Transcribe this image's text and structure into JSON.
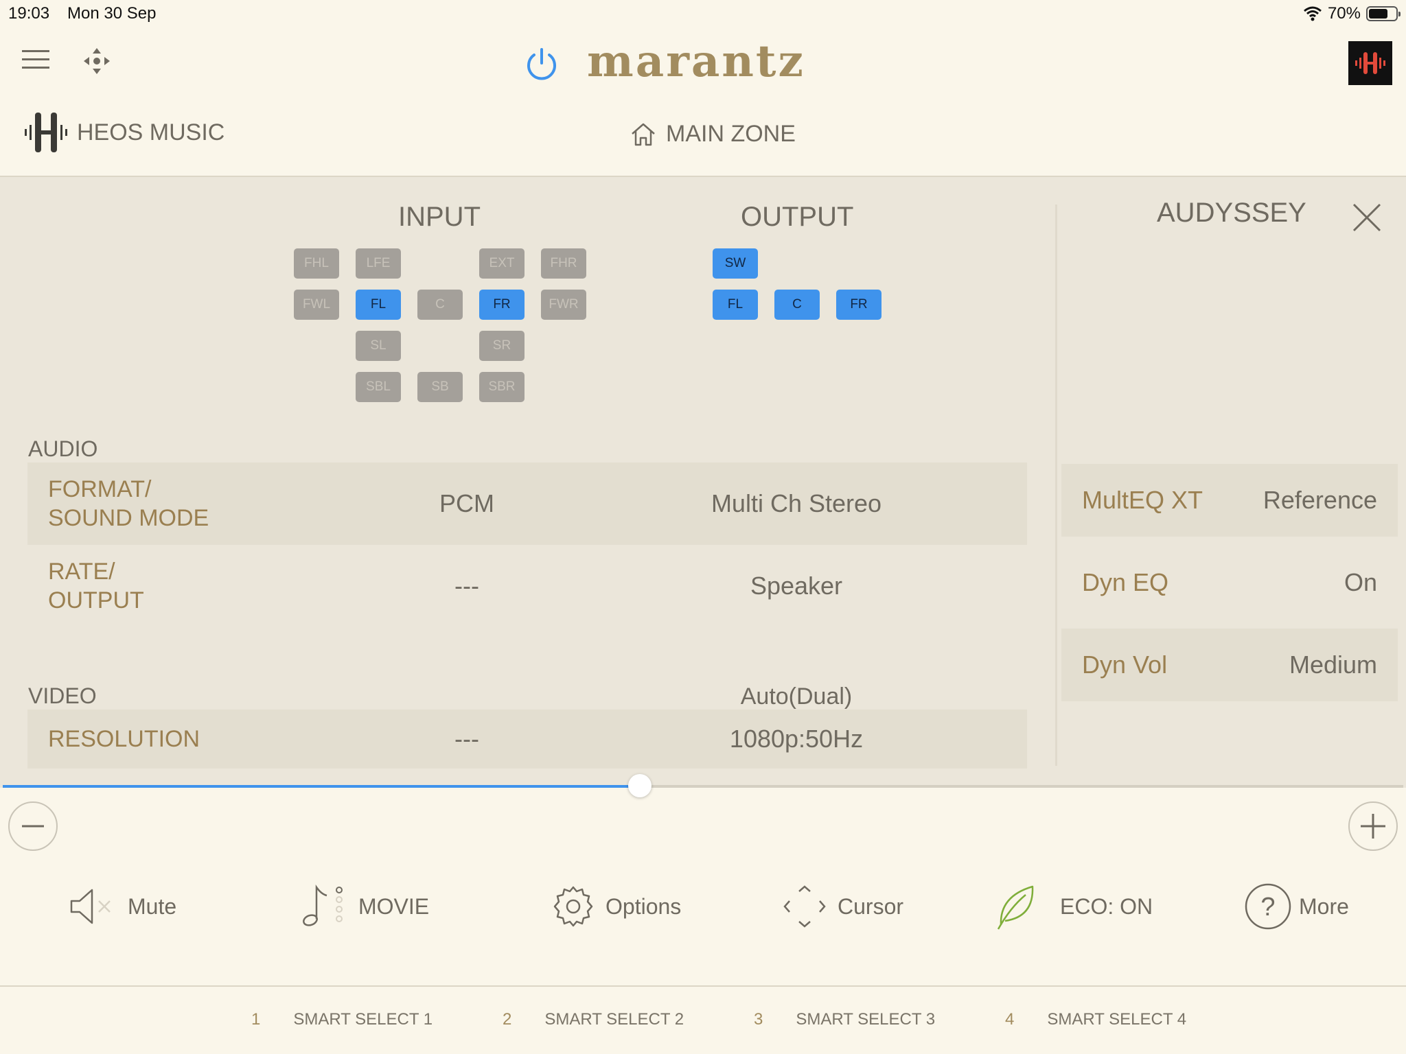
{
  "status": {
    "time": "19:03",
    "date": "Mon 30 Sep",
    "battery": "70%",
    "battery_level": 0.7
  },
  "header": {
    "brand": "marantz",
    "source_tab": "HEOS MUSIC",
    "zone": "MAIN ZONE"
  },
  "panel": {
    "input_title": "INPUT",
    "output_title": "OUTPUT",
    "audyssey_title": "AUDYSSEY",
    "input_channels": [
      {
        "label": "FHL",
        "active": false
      },
      {
        "label": "LFE",
        "active": false
      },
      {
        "label": "EXT",
        "active": false
      },
      {
        "label": "FHR",
        "active": false
      },
      {
        "label": "FWL",
        "active": false
      },
      {
        "label": "FL",
        "active": true
      },
      {
        "label": "C",
        "active": false
      },
      {
        "label": "FR",
        "active": true
      },
      {
        "label": "FWR",
        "active": false
      },
      {
        "label": "SL",
        "active": false
      },
      {
        "label": "SR",
        "active": false
      },
      {
        "label": "SBL",
        "active": false
      },
      {
        "label": "SB",
        "active": false
      },
      {
        "label": "SBR",
        "active": false
      }
    ],
    "output_channels": [
      {
        "label": "SW",
        "active": true
      },
      {
        "label": "FL",
        "active": true
      },
      {
        "label": "C",
        "active": true
      },
      {
        "label": "FR",
        "active": true
      }
    ],
    "audio_label": "AUDIO",
    "video_label": "VIDEO",
    "rows": {
      "format": {
        "label_1": "FORMAT/",
        "label_2": "SOUND MODE",
        "input": "PCM",
        "output": "Multi Ch Stereo"
      },
      "rate": {
        "label_1": "RATE/",
        "label_2": "OUTPUT",
        "input": "---",
        "output": "Speaker"
      },
      "video_mode": "Auto(Dual)",
      "resolution": {
        "label": "RESOLUTION",
        "input": "---",
        "output": "1080p:50Hz"
      }
    },
    "audyssey": [
      {
        "label": "MultEQ XT",
        "value": "Reference"
      },
      {
        "label": "Dyn EQ",
        "value": "On"
      },
      {
        "label": "Dyn Vol",
        "value": "Medium"
      }
    ]
  },
  "volume": {
    "level": 0.455
  },
  "controls": {
    "mute": "Mute",
    "sound_mode": "MOVIE",
    "options": "Options",
    "cursor": "Cursor",
    "eco": "ECO: ON",
    "more": "More"
  },
  "smart_select": [
    {
      "num": "1",
      "label": "SMART SELECT 1"
    },
    {
      "num": "2",
      "label": "SMART SELECT 2"
    },
    {
      "num": "3",
      "label": "SMART SELECT 3"
    },
    {
      "num": "4",
      "label": "SMART SELECT 4"
    }
  ],
  "colors": {
    "accent": "#3f93ec",
    "brand": "#a28c5f",
    "background": "#faf6ea",
    "panel": "#ebe6da"
  }
}
